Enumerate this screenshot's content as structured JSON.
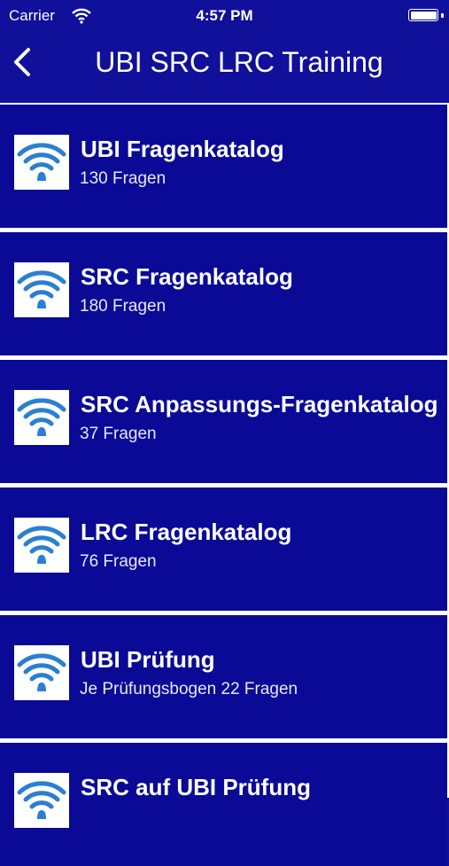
{
  "status": {
    "carrier": "Carrier",
    "time": "4:57 PM"
  },
  "nav": {
    "back_icon": "chevron-left-icon",
    "title": "UBI SRC LRC Training"
  },
  "colors": {
    "background": "#10109a",
    "cell": "#0a0a96",
    "icon_blue": "#2a7fd1",
    "text": "#ffffff"
  },
  "items": [
    {
      "title": "UBI Fragenkatalog",
      "subtitle": "130 Fragen",
      "icon": "wifi-signal-icon"
    },
    {
      "title": "SRC Fragenkatalog",
      "subtitle": "180 Fragen",
      "icon": "wifi-signal-icon"
    },
    {
      "title": "SRC Anpassungs-Fragenkatalog",
      "subtitle": "37 Fragen",
      "icon": "wifi-signal-icon"
    },
    {
      "title": "LRC Fragenkatalog",
      "subtitle": "76 Fragen",
      "icon": "wifi-signal-icon"
    },
    {
      "title": "UBI Prüfung",
      "subtitle": "Je Prüfungsbogen 22 Fragen",
      "icon": "wifi-signal-icon"
    },
    {
      "title": "SRC auf UBI Prüfung",
      "subtitle": "",
      "icon": "wifi-signal-icon"
    }
  ]
}
